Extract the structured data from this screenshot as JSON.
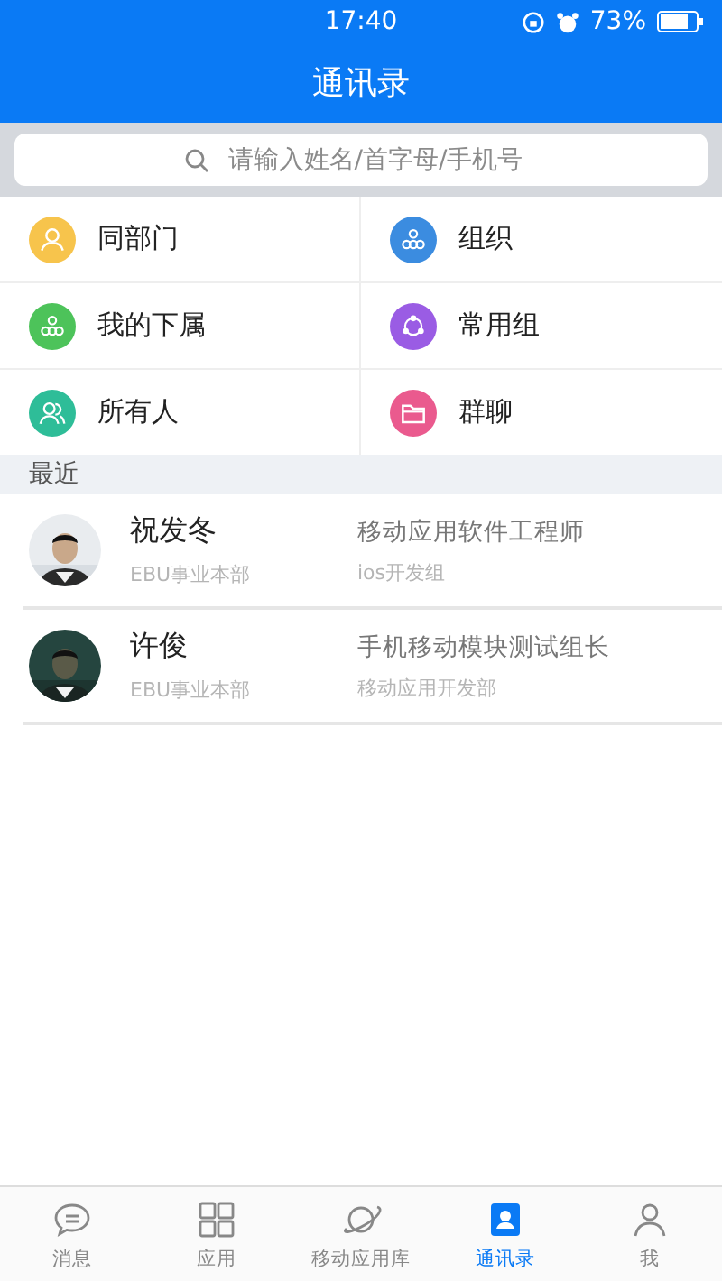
{
  "status_bar": {
    "time": "17:40",
    "battery": "73%"
  },
  "header": {
    "title": "通讯录"
  },
  "search": {
    "placeholder": "请输入姓名/首字母/手机号"
  },
  "shortcuts": [
    {
      "label": "同部门",
      "color": "#f7c44c",
      "kind": "person"
    },
    {
      "label": "组织",
      "color": "#3b8ce0",
      "kind": "org"
    },
    {
      "label": "我的下属",
      "color": "#4dc35a",
      "kind": "org"
    },
    {
      "label": "常用组",
      "color": "#9a5ce4",
      "kind": "circle"
    },
    {
      "label": "所有人",
      "color": "#2ebd98",
      "kind": "people"
    },
    {
      "label": "群聊",
      "color": "#ea5a8e",
      "kind": "folder"
    }
  ],
  "recent": {
    "title": "最近",
    "contacts": [
      {
        "name": "祝发冬",
        "dept": "EBU事业本部",
        "position": "移动应用软件工程师",
        "group": "ios开发组",
        "kind": "picture"
      },
      {
        "name": "许俊",
        "dept": "EBU事业本部",
        "position": "手机移动模块测试组长",
        "group": "移动应用开发部",
        "kind": "picture"
      }
    ]
  },
  "tabs": [
    {
      "label": "消息",
      "kind": "chat",
      "selected": false
    },
    {
      "label": "应用",
      "kind": "grid",
      "selected": false
    },
    {
      "label": "移动应用库",
      "kind": "planet",
      "selected": false
    },
    {
      "label": "通讯录",
      "kind": "contacts",
      "selected": true
    },
    {
      "label": "我",
      "kind": "me",
      "selected": false
    }
  ]
}
